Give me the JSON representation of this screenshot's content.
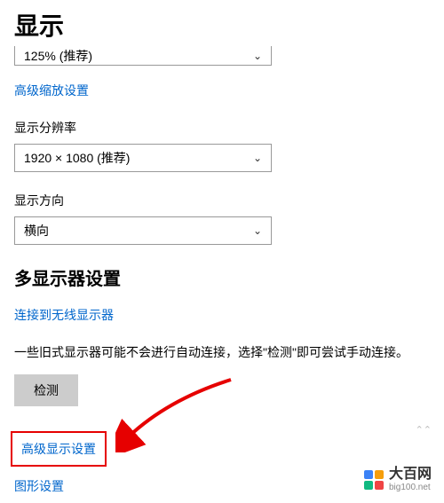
{
  "pageTitle": "显示",
  "scale": {
    "value": "125% (推荐)"
  },
  "advancedScalingLink": "高级缩放设置",
  "resolution": {
    "label": "显示分辨率",
    "value": "1920 × 1080 (推荐)"
  },
  "orientation": {
    "label": "显示方向",
    "value": "横向"
  },
  "multiMonitor": {
    "title": "多显示器设置",
    "connectWirelessLink": "连接到无线显示器",
    "legacyText": "一些旧式显示器可能不会进行自动连接，选择\"检测\"即可尝试手动连接。",
    "detectButton": "检测"
  },
  "advancedDisplayLink": "高级显示设置",
  "graphicsSettingsLink": "图形设置",
  "watermark": {
    "main": "大百网",
    "sub": "big100.net"
  },
  "logoColors": {
    "a": "#3b82f6",
    "b": "#f59e0b",
    "c": "#10b981",
    "d": "#ef4444"
  }
}
